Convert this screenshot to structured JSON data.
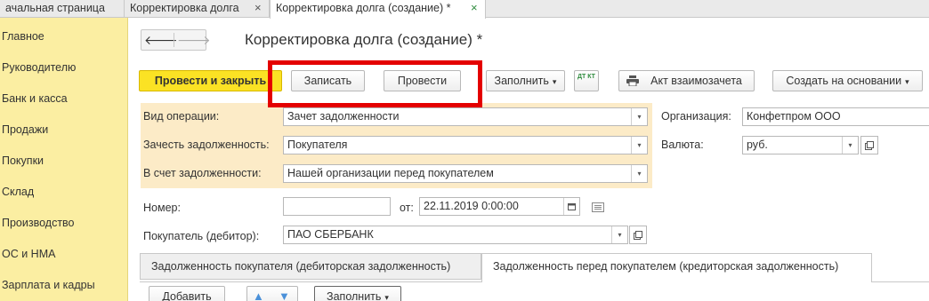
{
  "tabs": [
    {
      "label": "ачальная страница",
      "closable": false,
      "active": false
    },
    {
      "label": "Корректировка долга",
      "closable": true,
      "active": false
    },
    {
      "label": "Корректировка долга (создание) *",
      "closable": true,
      "active": true
    }
  ],
  "close_glyph": "×",
  "sidebar": {
    "items": [
      {
        "label": "Главное"
      },
      {
        "label": "Руководителю"
      },
      {
        "label": "Банк и касса"
      },
      {
        "label": "Продажи"
      },
      {
        "label": "Покупки"
      },
      {
        "label": "Склад"
      },
      {
        "label": "Производство"
      },
      {
        "label": "ОС и НМА"
      },
      {
        "label": "Зарплата и кадры"
      }
    ]
  },
  "nav": {
    "back_glyph": "🡐",
    "forward_glyph": "🡒"
  },
  "page_title": "Корректировка долга (создание) *",
  "toolbar": {
    "post_close": "Провести и закрыть",
    "save": "Записать",
    "post": "Провести",
    "fill": "Заполнить",
    "dt_kt": "ДТ КТ",
    "print_act": "Акт взаимозачета",
    "create_based": "Создать на основании"
  },
  "dropdown_caret": "▾",
  "form": {
    "operation_type": {
      "label": "Вид операции:",
      "value": "Зачет задолженности"
    },
    "offset_debt": {
      "label": "Зачесть задолженность:",
      "value": "Покупателя"
    },
    "against_debt": {
      "label": "В счет задолженности:",
      "value": "Нашей организации перед покупателем"
    },
    "organization": {
      "label": "Организация:",
      "value": "Конфетпром ООО"
    },
    "currency": {
      "label": "Валюта:",
      "value": "руб."
    },
    "number": {
      "label": "Номер:",
      "value": ""
    },
    "date": {
      "label": "от:",
      "value": "22.11.2019  0:00:00"
    },
    "buyer": {
      "label": "Покупатель (дебитор):",
      "value": "ПАО СБЕРБАНК"
    }
  },
  "panel_tabs": [
    {
      "label": "Задолженность покупателя (дебиторская задолженность)",
      "active": false
    },
    {
      "label": "Задолженность перед покупателем (кредиторская задолженность)",
      "active": true
    }
  ],
  "table_toolbar": {
    "add": "Добавить",
    "fill": "Заполнить"
  },
  "colors": {
    "accent_yellow": "#fbe224",
    "sidebar": "#fbeea2",
    "form_highlight": "#fcebc7",
    "callout": "#e40000"
  }
}
